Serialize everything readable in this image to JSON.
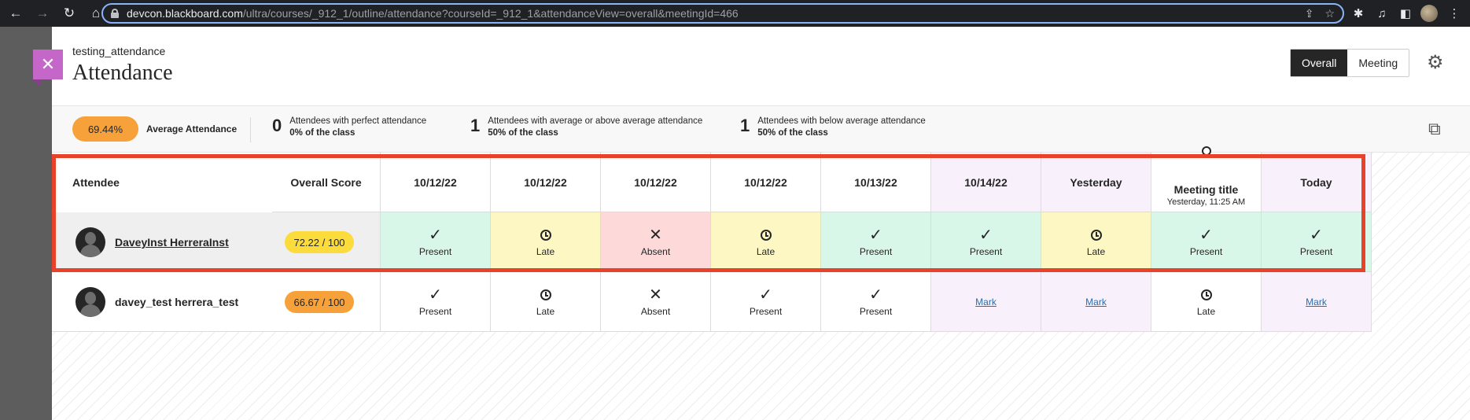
{
  "browser": {
    "url_host": "devcon.blackboard.com",
    "url_path": "/ultra/courses/_912_1/outline/attendance?courseId=_912_1&attendanceView=overall&meetingId=466"
  },
  "header": {
    "course_name": "testing_attendance",
    "title": "Attendance",
    "view_options": [
      "Overall",
      "Meeting"
    ],
    "active_view": "Overall"
  },
  "summary": {
    "average_value": "69.44%",
    "average_label": "Average Attendance",
    "stats": [
      {
        "num": "0",
        "line1": "Attendees with perfect attendance",
        "line2": "0% of the class"
      },
      {
        "num": "1",
        "line1": "Attendees with average or above average attendance",
        "line2": "50% of the class"
      },
      {
        "num": "1",
        "line1": "Attendees with below average attendance",
        "line2": "50% of the class"
      }
    ]
  },
  "table": {
    "headers": {
      "attendee": "Attendee",
      "score": "Overall Score",
      "sessions": [
        "10/12/22",
        "10/12/22",
        "10/12/22",
        "10/12/22",
        "10/13/22",
        "10/14/22",
        "Yesterday",
        "Meeting title",
        "Today"
      ],
      "meeting_sub": "Yesterday, 11:25 AM"
    },
    "rows": [
      {
        "name": "DaveyInst HerreraInst",
        "score": "72.22 / 100",
        "marks": [
          "Present",
          "Late",
          "Absent",
          "Late",
          "Present",
          "Present",
          "Late",
          "Present",
          "Present"
        ]
      },
      {
        "name": "davey_test herrera_test",
        "score": "66.67 / 100",
        "marks": [
          "Present",
          "Late",
          "Absent",
          "Present",
          "Present",
          "Mark",
          "Mark",
          "Late",
          "Mark"
        ]
      }
    ]
  },
  "colors": {
    "present_bg": "#d9f7e8",
    "late_bg": "#fdf7c3",
    "absent_bg": "#fdd9d9",
    "future_bg": "#f8f0fa",
    "highlight": "#e8432a",
    "close_tab": "#c467c9"
  }
}
